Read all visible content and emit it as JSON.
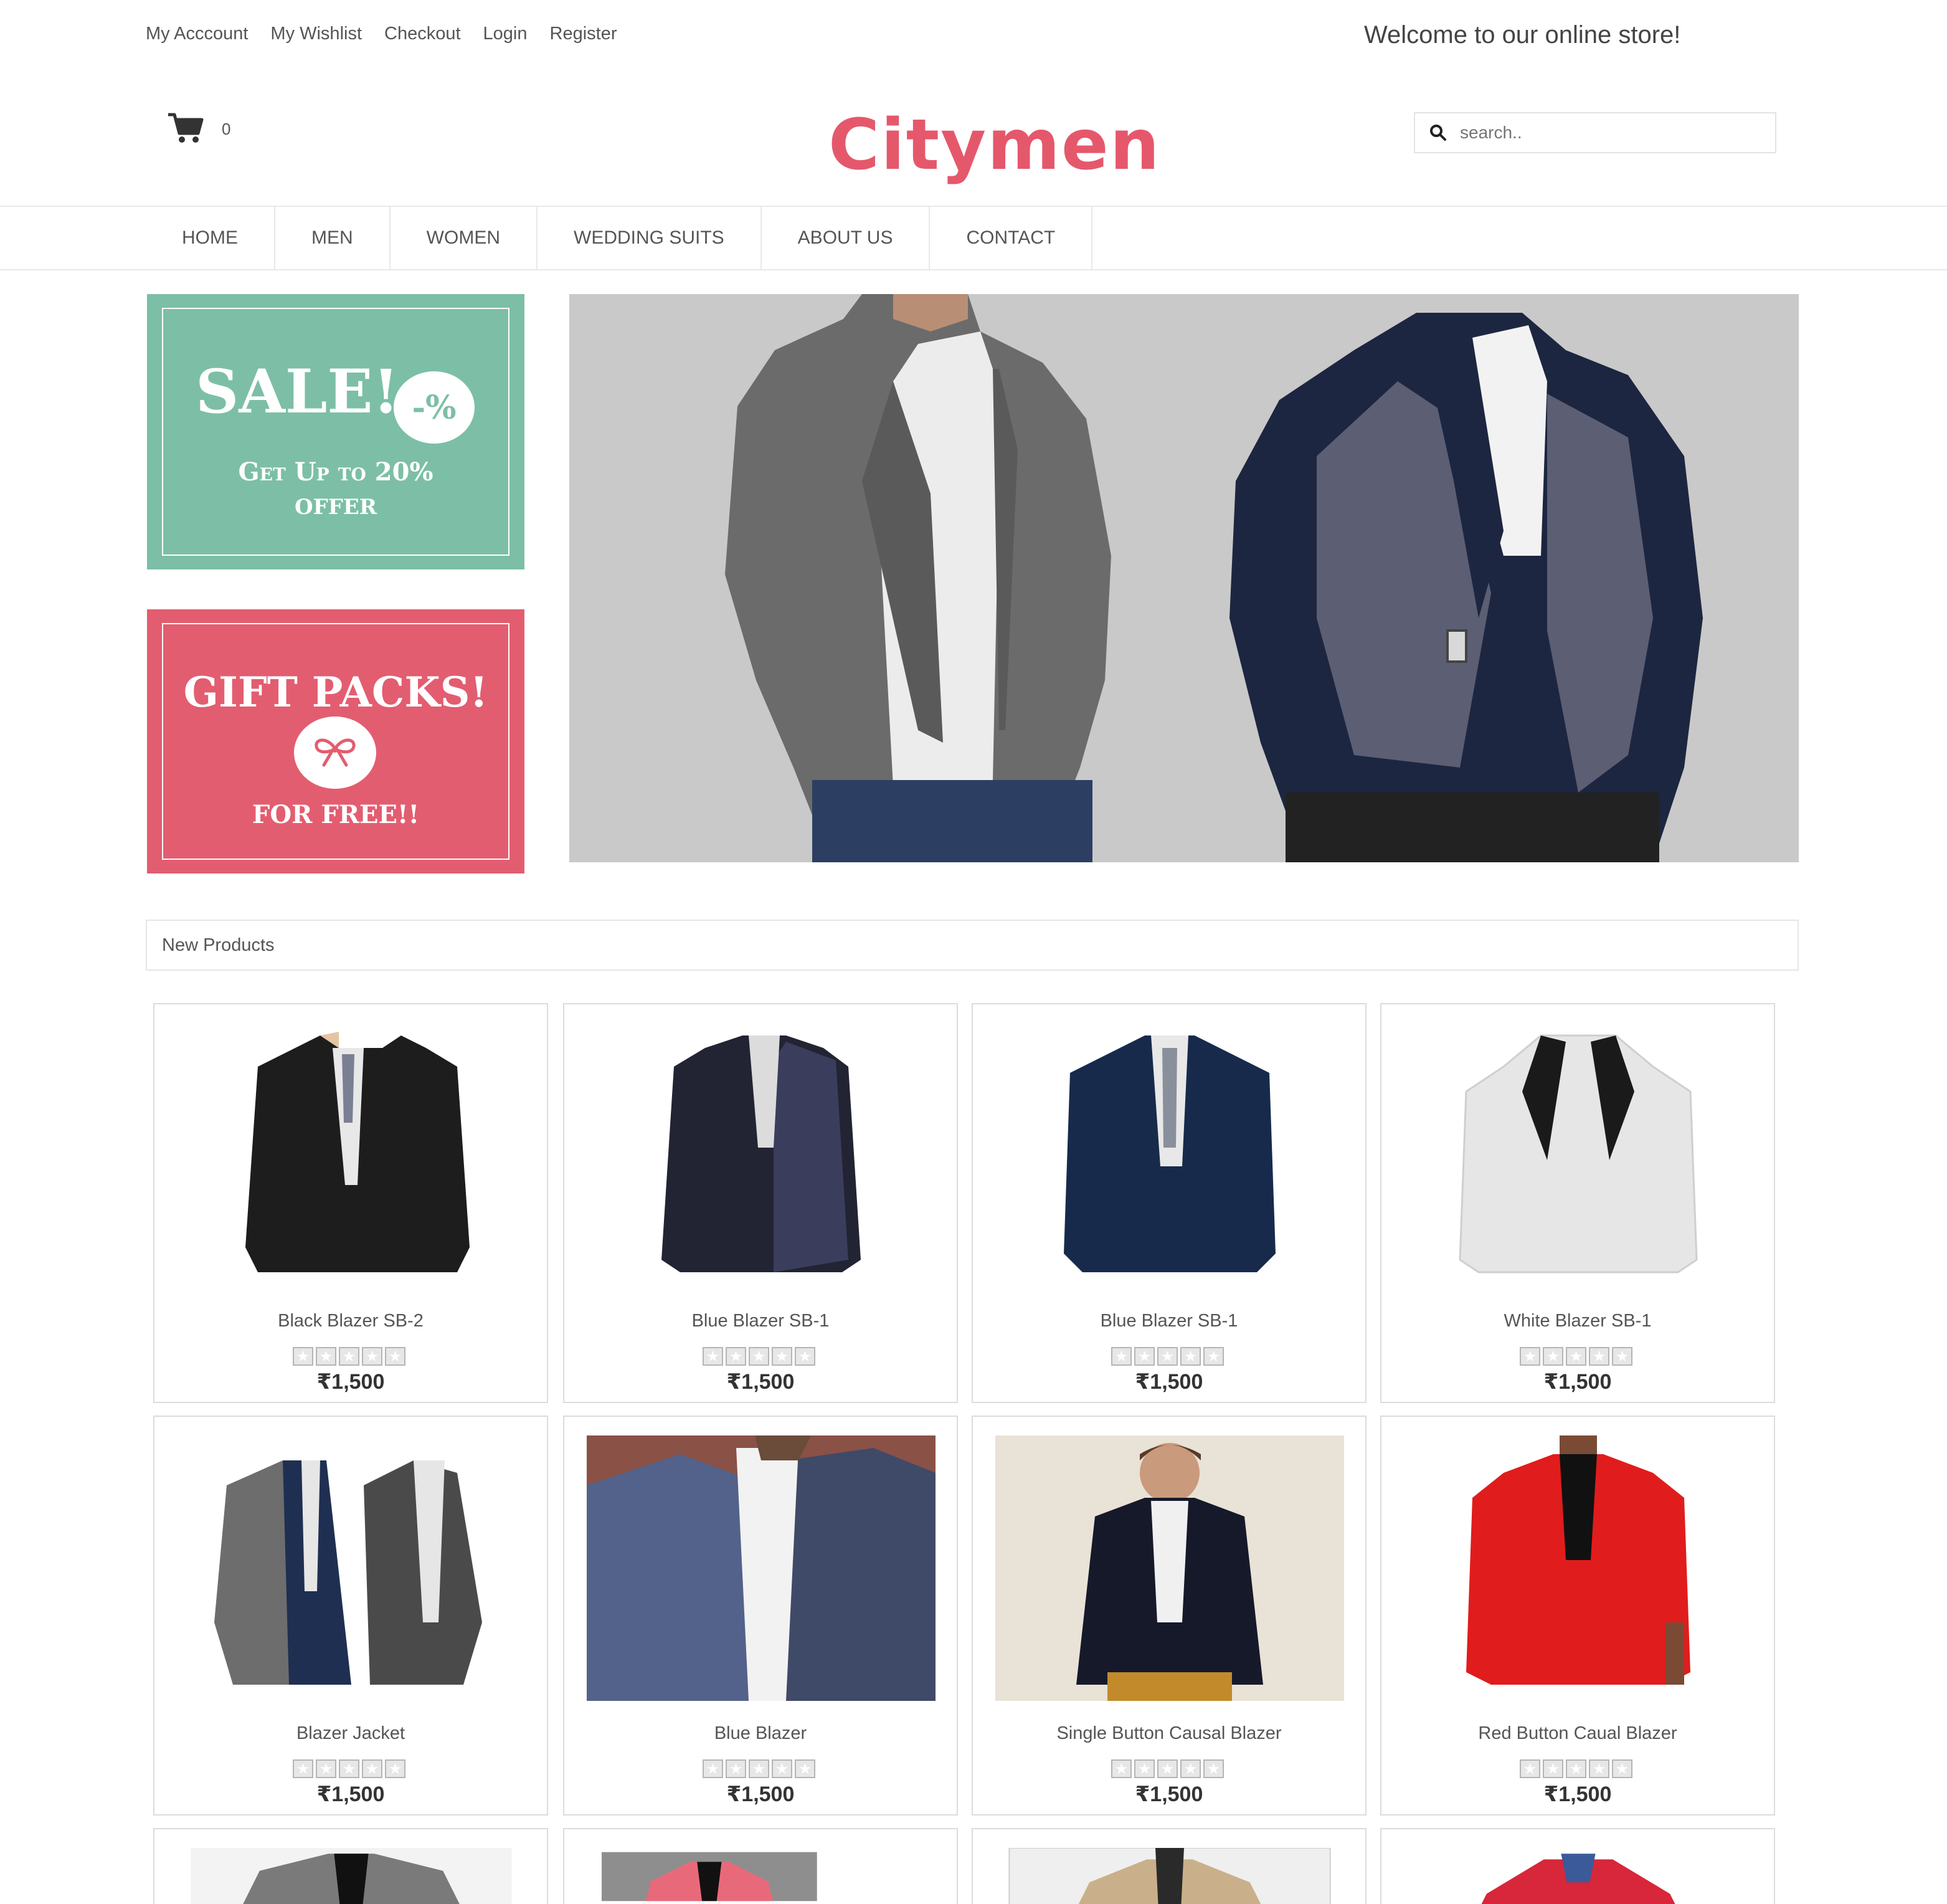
{
  "toplinks": [
    "My Acccount",
    "My Wishlist",
    "Checkout",
    "Login",
    "Register"
  ],
  "welcome": "Welcome to our online store!",
  "cart_count": "0",
  "logo": "Citymen",
  "search_placeholder": "search..",
  "nav": [
    "HOME",
    "MEN",
    "WOMEN",
    "WEDDING SUITS",
    "ABOUT US",
    "CONTACT"
  ],
  "promo_sale": {
    "title": "SALE!",
    "badge": "-%",
    "line1": "Get Up to 20%",
    "line2": "OFFER"
  },
  "promo_gift": {
    "title": "GIFT PACKS!",
    "sub": "FOR FREE!!"
  },
  "section_title": "New Products",
  "products": [
    {
      "name": "Black Blazer SB-2",
      "price": "₹1,500",
      "rating": 0
    },
    {
      "name": "Blue Blazer SB-1",
      "price": "₹1,500",
      "rating": 0
    },
    {
      "name": "Blue Blazer SB-1",
      "price": "₹1,500",
      "rating": 0
    },
    {
      "name": "White Blazer SB-1",
      "price": "₹1,500",
      "rating": 0
    },
    {
      "name": "Blazer Jacket",
      "price": "₹1,500",
      "rating": 0
    },
    {
      "name": "Blue Blazer",
      "price": "₹1,500",
      "rating": 0
    },
    {
      "name": "Single Button Causal Blazer",
      "price": "₹1,500",
      "rating": 0
    },
    {
      "name": "Red Button Caual Blazer",
      "price": "₹1,500",
      "rating": 0
    }
  ],
  "colors": {
    "brand": "#e5586c",
    "sale_green": "#7cbfa6",
    "gift_pink": "#e35d70"
  }
}
